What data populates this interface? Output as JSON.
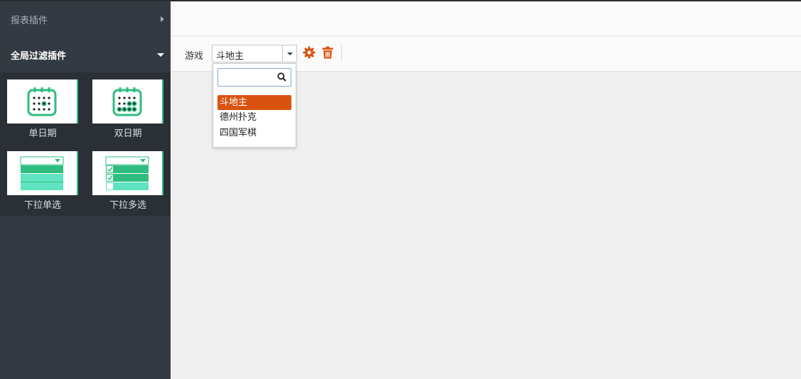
{
  "sidebar": {
    "sections": [
      {
        "label": "报表插件",
        "expanded": false
      },
      {
        "label": "全局过滤插件",
        "expanded": true
      }
    ],
    "widgets": [
      {
        "label": "单日期",
        "icon": "single-date-calendar-icon"
      },
      {
        "label": "双日期",
        "icon": "double-date-calendar-icon"
      },
      {
        "label": "下拉单选",
        "icon": "dropdown-single-select-icon"
      },
      {
        "label": "下拉多选",
        "icon": "dropdown-multi-select-icon"
      }
    ]
  },
  "filter": {
    "label": "游戏",
    "selected": "斗地主",
    "search_placeholder": "",
    "options": [
      "斗地主",
      "德州扑克",
      "四国军棋"
    ]
  },
  "colors": {
    "sidebar_bg": "#343a41",
    "widget_panel_bg": "#2b3036",
    "accent_green": "#2ebd7f",
    "accent_orange": "#d9530f"
  }
}
